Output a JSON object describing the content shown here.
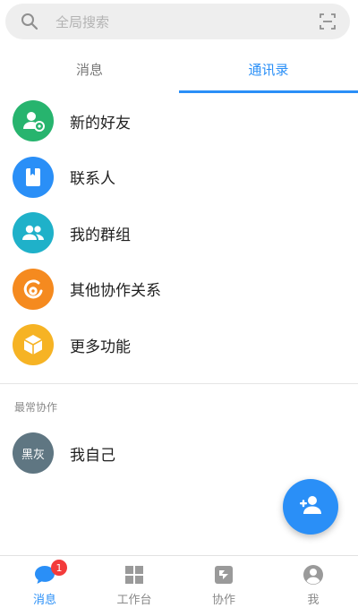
{
  "search": {
    "placeholder": "全局搜索"
  },
  "tabs": [
    {
      "label": "消息",
      "active": false
    },
    {
      "label": "通讯录",
      "active": true
    }
  ],
  "menu": [
    {
      "label": "新的好友",
      "icon": "add-user-icon",
      "color": "#27b46e"
    },
    {
      "label": "联系人",
      "icon": "contact-book-icon",
      "color": "#2a8ff7"
    },
    {
      "label": "我的群组",
      "icon": "group-icon",
      "color": "#1fb1c9"
    },
    {
      "label": "其他协作关系",
      "icon": "collaboration-icon",
      "color": "#f58a1f"
    },
    {
      "label": "更多功能",
      "icon": "cube-icon",
      "color": "#f6b324"
    }
  ],
  "frequent": {
    "title": "最常协作",
    "items": [
      {
        "avatar_text": "黑灰",
        "name": "我自己"
      }
    ]
  },
  "bottom_nav": [
    {
      "label": "消息",
      "icon": "message-icon",
      "badge": "1",
      "active": true
    },
    {
      "label": "工作台",
      "icon": "grid-icon",
      "active": false
    },
    {
      "label": "协作",
      "icon": "collaborate-icon",
      "active": false
    },
    {
      "label": "我",
      "icon": "profile-icon",
      "active": false
    }
  ],
  "colors": {
    "accent": "#2a8ff7",
    "badge": "#f33b3b"
  }
}
